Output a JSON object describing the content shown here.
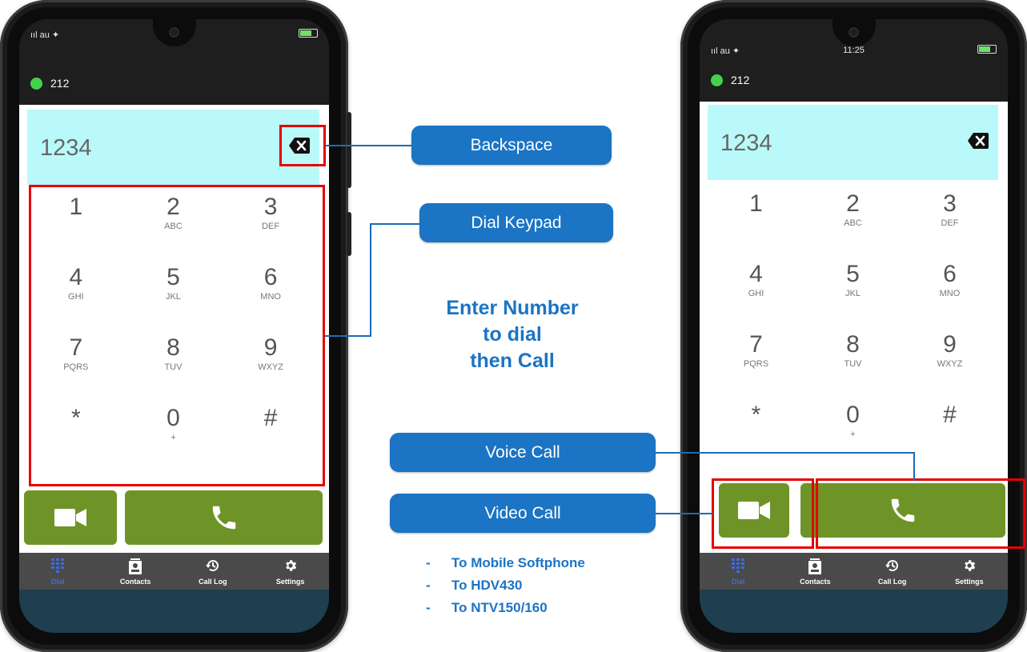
{
  "status_bar": {
    "carrier": "ııl au ✦",
    "time": "11:25"
  },
  "presence": {
    "extension": "212",
    "status_color": "#46d14a"
  },
  "dialer": {
    "entered_number": "1234"
  },
  "keypad": [
    {
      "digit": "1",
      "letters": ""
    },
    {
      "digit": "2",
      "letters": "ABC"
    },
    {
      "digit": "3",
      "letters": "DEF"
    },
    {
      "digit": "4",
      "letters": "GHI"
    },
    {
      "digit": "5",
      "letters": "JKL"
    },
    {
      "digit": "6",
      "letters": "MNO"
    },
    {
      "digit": "7",
      "letters": "PQRS"
    },
    {
      "digit": "8",
      "letters": "TUV"
    },
    {
      "digit": "9",
      "letters": "WXYZ"
    },
    {
      "digit": "*",
      "letters": ""
    },
    {
      "digit": "0",
      "letters": "+"
    },
    {
      "digit": "#",
      "letters": ""
    }
  ],
  "buttons": {
    "video_icon": "video-camera-icon",
    "call_icon": "phone-icon",
    "button_color": "#6e9428"
  },
  "tabs": [
    {
      "label": "Dial",
      "icon": "dialpad-icon"
    },
    {
      "label": "Contacts",
      "icon": "contacts-icon"
    },
    {
      "label": "Call Log",
      "icon": "history-icon"
    },
    {
      "label": "Settings",
      "icon": "gear-icon"
    }
  ],
  "callouts": {
    "backspace": "Backspace",
    "dial_keypad": "Dial Keypad",
    "voice_call": "Voice Call",
    "video_call": "Video Call"
  },
  "instruction": {
    "line1": "Enter Number",
    "line2": "to dial",
    "line3": "then Call"
  },
  "targets": [
    "To Mobile Softphone",
    "To HDV430",
    "To NTV150/160"
  ],
  "colors": {
    "accent_blue": "#1b74c4",
    "highlight_red": "#e50000",
    "display_bg": "#baf9f9",
    "tab_bar": "#4a4a4a"
  }
}
